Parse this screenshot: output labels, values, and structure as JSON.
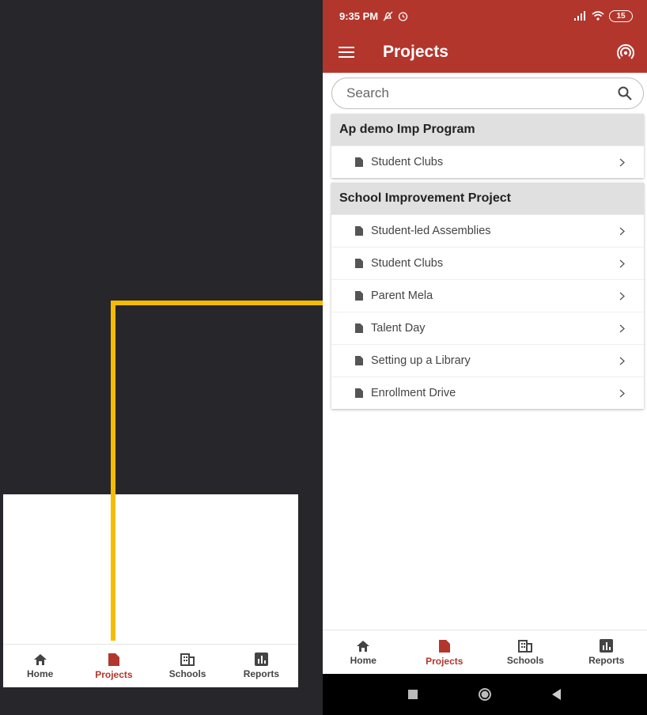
{
  "status": {
    "time": "9:35 PM",
    "battery": "15"
  },
  "appbar": {
    "title": "Projects"
  },
  "search": {
    "placeholder": "Search"
  },
  "groups": [
    {
      "title": "Ap demo Imp Program",
      "items": [
        "Student Clubs"
      ]
    },
    {
      "title": "School Improvement Project",
      "items": [
        "Student-led Assemblies",
        "Student Clubs",
        "Parent Mela",
        "Talent Day",
        "Setting up a Library",
        "Enrollment Drive"
      ]
    }
  ],
  "nav": {
    "home": "Home",
    "projects": "Projects",
    "schools": "Schools",
    "reports": "Reports",
    "active": "projects"
  },
  "colors": {
    "primary": "#b3362d",
    "callout": "#f6bb00",
    "background": "#26262b"
  }
}
